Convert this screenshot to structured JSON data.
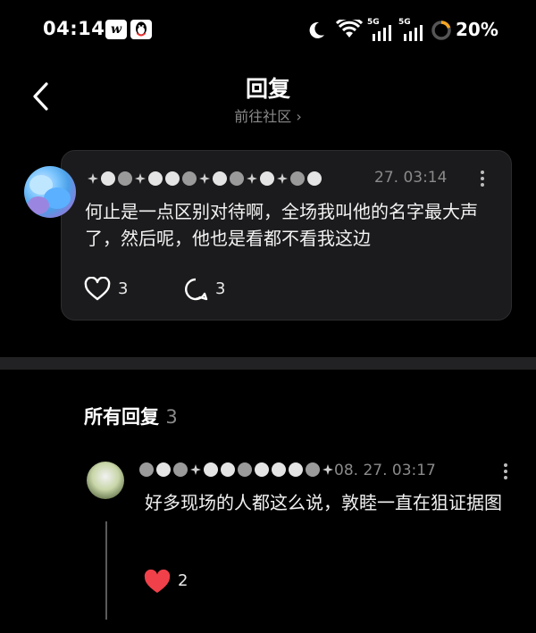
{
  "status_bar": {
    "time": "04:14",
    "app_badge_1": "w",
    "signal_1_label": "5G",
    "signal_2_label": "5G",
    "battery": "20%"
  },
  "header": {
    "title": "回复",
    "sublink": "前往社区 ›"
  },
  "post": {
    "date": "27. 03:14",
    "text": "何止是一点区别对待啊，全场我叫他的名字最大声了，然后呢，他也是看都不看我这边",
    "likes": "3",
    "comments": "3"
  },
  "replies": {
    "heading": "所有回复",
    "count": "3",
    "items": [
      {
        "date": "08. 27. 03:17",
        "text": "好多现场的人都这么说，敦睦一直在狙证据图",
        "likes": "2"
      }
    ]
  },
  "colors": {
    "background": "#000000",
    "card": "#1b1b1d",
    "muted_text": "#8a8a8a",
    "like_active": "#f0404a"
  }
}
